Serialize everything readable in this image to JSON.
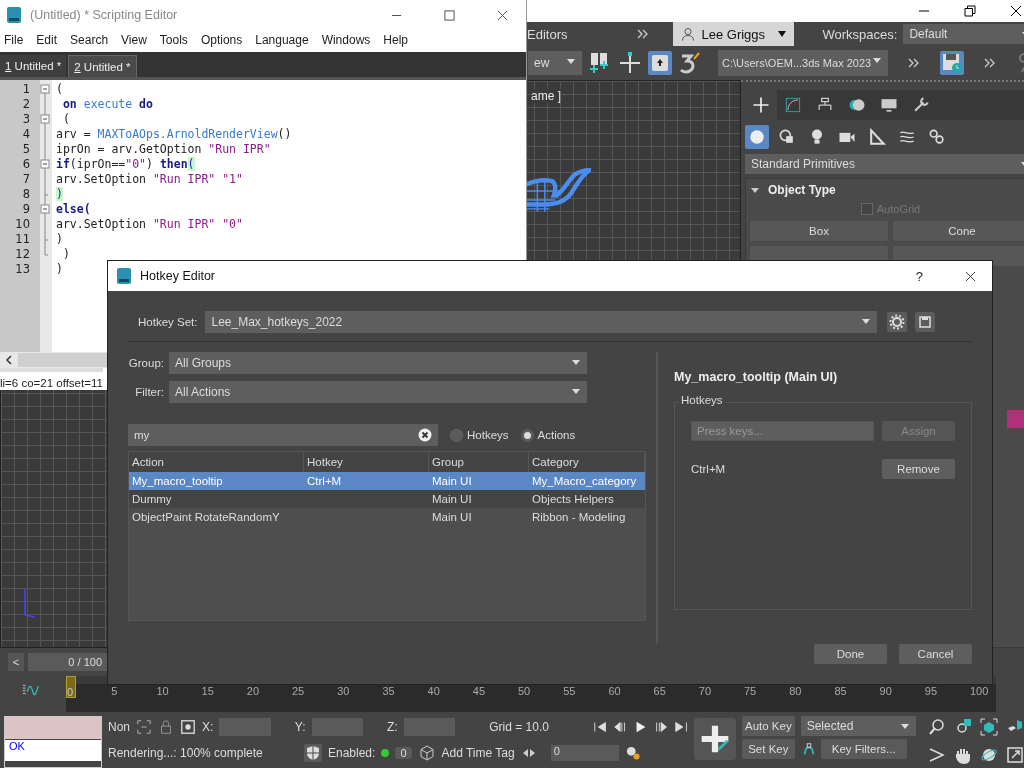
{
  "max_window": {
    "menu_bar": {
      "menu_item": "Editors",
      "user": "Lee Griggs",
      "workspaces_label": "Workspaces:",
      "workspace": "Default"
    },
    "toolbar": {
      "view_dropdown": "ew",
      "project_path": "C:\\Users\\OEM...3ds Max 2023"
    },
    "viewport": {
      "label": "ame ]"
    },
    "command_panel": {
      "tabs": [
        {
          "selected": true
        },
        {
          "selected": false
        },
        {
          "selected": false
        },
        {
          "selected": false
        },
        {
          "selected": false
        },
        {
          "selected": false
        }
      ],
      "categories": [
        {
          "selected": true
        },
        {
          "selected": false
        },
        {
          "selected": false
        },
        {
          "selected": false
        },
        {
          "selected": false
        },
        {
          "selected": false
        },
        {
          "selected": false
        }
      ],
      "dropdown": "Standard Primitives",
      "rollout": {
        "title": "Object Type",
        "expanded": true,
        "autogrid": {
          "label": "AutoGrid",
          "checked": false,
          "disabled": true
        },
        "buttons": [
          "Box",
          "Cone"
        ]
      }
    },
    "timeline": {
      "prev": "<",
      "frame_slider": "0 / 100",
      "ruler": [
        {
          "label": "0",
          "current": true
        },
        {
          "label": "5",
          "current": false
        },
        {
          "label": "10",
          "current": false
        },
        {
          "label": "15",
          "current": false
        },
        {
          "label": "20",
          "current": false
        },
        {
          "label": "25",
          "current": false
        },
        {
          "label": "30",
          "current": false
        },
        {
          "label": "35",
          "current": false
        },
        {
          "label": "40",
          "current": false
        },
        {
          "label": "45",
          "current": false
        },
        {
          "label": "50",
          "current": false
        },
        {
          "label": "55",
          "current": false
        },
        {
          "label": "60",
          "current": false
        },
        {
          "label": "65",
          "current": false
        },
        {
          "label": "70",
          "current": false
        },
        {
          "label": "75",
          "current": false
        },
        {
          "label": "80",
          "current": false
        },
        {
          "label": "85",
          "current": false
        },
        {
          "label": "90",
          "current": false
        },
        {
          "label": "95",
          "current": false
        },
        {
          "label": "100",
          "current": false
        }
      ]
    },
    "status_bar": {
      "listener_output": "OK",
      "selection": "Non",
      "x_label": "X:",
      "y_label": "Y:",
      "z_label": "Z:",
      "grid": "Grid = 10.0",
      "prompt": "Rendering...: 100% complete",
      "adaptive_label": "Enabled:",
      "adaptive_on": true,
      "adaptive_count": "0",
      "time_tag": "Add Time Tag",
      "frame": "0",
      "auto_key": "Auto Key",
      "set_key": "Set Key",
      "key_set": "Selected",
      "key_filters": "Key Filters..."
    }
  },
  "script_editor": {
    "title": "(Untitled) * Scripting Editor",
    "menus": [
      "File",
      "Edit",
      "Search",
      "View",
      "Tools",
      "Options",
      "Language",
      "Windows",
      "Help"
    ],
    "tabs": [
      {
        "number": "1",
        "label": "Untitled *",
        "selected": false
      },
      {
        "number": "2",
        "label": "Untitled *",
        "selected": true
      }
    ],
    "lines": [
      {
        "number": "1",
        "kind": "start",
        "tokens": [
          {
            "text": "(",
            "kind": "plain"
          }
        ]
      },
      {
        "number": "2",
        "kind": "line",
        "tokens": [
          {
            "text": " on",
            "kind": "keyword"
          },
          {
            "text": " execute",
            "kind": "name"
          },
          {
            "text": " do",
            "kind": "keyword"
          }
        ]
      },
      {
        "number": "3",
        "kind": "start",
        "tokens": [
          {
            "text": " (",
            "kind": "plain"
          }
        ]
      },
      {
        "number": "4",
        "kind": "line",
        "tokens": [
          {
            "text": "arv = ",
            "kind": "plain"
          },
          {
            "text": "MAXToAOps.ArnoldRenderView",
            "kind": "name"
          },
          {
            "text": "()",
            "kind": "plain"
          }
        ]
      },
      {
        "number": "5",
        "kind": "line",
        "tokens": [
          {
            "text": "iprOn = arv.GetOption ",
            "kind": "plain"
          },
          {
            "text": "\"Run IPR\"",
            "kind": "string"
          }
        ]
      },
      {
        "number": "6",
        "kind": "start",
        "tokens": [
          {
            "text": "if",
            "kind": "keyword"
          },
          {
            "text": "(iprOn==",
            "kind": "plain"
          },
          {
            "text": "\"0\"",
            "kind": "string"
          },
          {
            "text": ") ",
            "kind": "plain"
          },
          {
            "text": "then",
            "kind": "keyword"
          },
          {
            "text": "(",
            "kind": "brace"
          }
        ]
      },
      {
        "number": "7",
        "kind": "line",
        "tokens": [
          {
            "text": "arv.SetOption ",
            "kind": "plain"
          },
          {
            "text": "\"Run IPR\" \"1\"",
            "kind": "string"
          }
        ]
      },
      {
        "number": "8",
        "kind": "tick",
        "tokens": [
          {
            "text": ")",
            "kind": "brace"
          }
        ]
      },
      {
        "number": "9",
        "kind": "start",
        "tokens": [
          {
            "text": "else(",
            "kind": "keyword"
          }
        ]
      },
      {
        "number": "10",
        "kind": "line",
        "tokens": [
          {
            "text": "arv.SetOption ",
            "kind": "plain"
          },
          {
            "text": "\"Run IPR\" \"0\"",
            "kind": "string"
          }
        ]
      },
      {
        "number": "11",
        "kind": "tick",
        "tokens": [
          {
            "text": ")",
            "kind": "plain"
          }
        ]
      },
      {
        "number": "12",
        "kind": "end",
        "tokens": [
          {
            "text": " )",
            "kind": "plain"
          }
        ]
      },
      {
        "number": "13",
        "kind": "none",
        "tokens": [
          {
            "text": ")",
            "kind": "plain"
          }
        ]
      }
    ],
    "status": "li=6 co=21 offset=11"
  },
  "hotkey_editor": {
    "title": "Hotkey Editor",
    "help": "?",
    "hotkey_set_label": "Hotkey Set:",
    "hotkey_set": "Lee_Max_hotkeys_2022",
    "group_label": "Group:",
    "group": "All Groups",
    "filter_label": "Filter:",
    "filter": "All Actions",
    "search": "my",
    "search_modes": [
      {
        "label": "Hotkeys",
        "selected": false
      },
      {
        "label": "Actions",
        "selected": true
      }
    ],
    "columns": [
      "Action",
      "Hotkey",
      "Group",
      "Category"
    ],
    "rows": [
      {
        "cells": [
          "My_macro_tooltip",
          "Ctrl+M",
          "Main UI",
          "My_Macro_category"
        ],
        "selected": true
      },
      {
        "cells": [
          "Dummy",
          "",
          "Main UI",
          "Objects Helpers"
        ],
        "selected": false
      },
      {
        "cells": [
          "ObjectPaint RotateRandomY",
          "",
          "Main UI",
          "Ribbon - Modeling"
        ],
        "selected": false
      }
    ],
    "detail_title": "My_macro_tooltip (Main UI)",
    "hotkeys_group": "Hotkeys",
    "keys_placeholder": "Press keys...",
    "assign": {
      "label": "Assign",
      "disabled": true
    },
    "assigned": [
      {
        "keys": "Ctrl+M",
        "action": "Remove"
      }
    ],
    "buttons": [
      "Done",
      "Cancel"
    ]
  }
}
